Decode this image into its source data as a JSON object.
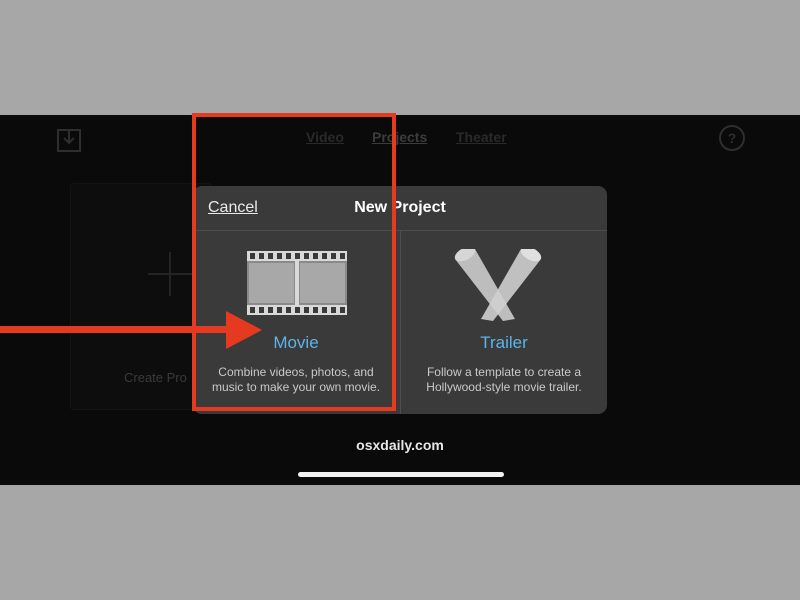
{
  "nav": {
    "tabs": [
      {
        "label": "Video"
      },
      {
        "label": "Projects"
      },
      {
        "label": "Theater"
      }
    ],
    "help_label": "?"
  },
  "create_project": {
    "label": "Create Pro"
  },
  "dialog": {
    "cancel_label": "Cancel",
    "title": "New Project",
    "options": [
      {
        "title": "Movie",
        "description_line1": "Combine videos, photos, and",
        "description_line2": "music to make your own movie.",
        "icon": "film-strip-icon"
      },
      {
        "title": "Trailer",
        "description_line1": "Follow a template to create a",
        "description_line2": "Hollywood-style movie trailer.",
        "icon": "spotlights-icon"
      }
    ]
  },
  "watermark": "osxdaily.com",
  "colors": {
    "accent": "#5db4e8",
    "highlight": "#e53a1f",
    "dialog_bg": "#3a3a3a",
    "screen_bg": "#0a0a0a",
    "page_bg": "#a7a7a7"
  },
  "icons": [
    "import-icon",
    "help-icon",
    "plus-icon",
    "arrow-icon"
  ]
}
